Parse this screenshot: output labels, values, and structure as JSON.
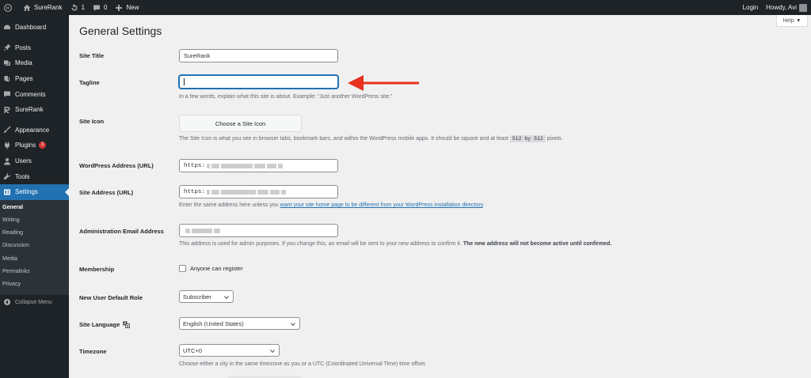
{
  "admin_bar": {
    "site_name": "SureRank",
    "updates_count": "1",
    "comments_count": "0",
    "new_label": "New",
    "login_label": "Login",
    "howdy_label": "Howdy, Avi"
  },
  "sidebar": {
    "items": [
      {
        "label": "Dashboard",
        "icon": "dashboard-icon"
      },
      {
        "label": "Posts",
        "icon": "pin-icon"
      },
      {
        "label": "Media",
        "icon": "media-icon"
      },
      {
        "label": "Pages",
        "icon": "pages-icon"
      },
      {
        "label": "Comments",
        "icon": "comment-icon"
      },
      {
        "label": "SureRank",
        "icon": "surerank-icon"
      },
      {
        "label": "Appearance",
        "icon": "brush-icon"
      },
      {
        "label": "Plugins",
        "icon": "plug-icon",
        "badge": "1"
      },
      {
        "label": "Users",
        "icon": "user-icon"
      },
      {
        "label": "Tools",
        "icon": "wrench-icon"
      },
      {
        "label": "Settings",
        "icon": "settings-icon"
      }
    ],
    "submenu": [
      "General",
      "Writing",
      "Reading",
      "Discussion",
      "Media",
      "Permalinks",
      "Privacy"
    ],
    "collapse_label": "Collapse Menu"
  },
  "help_label": "Help ▼",
  "page_title": "General Settings",
  "fields": {
    "site_title": {
      "label": "Site Title",
      "value": "SureRank"
    },
    "tagline": {
      "label": "Tagline",
      "value": "",
      "description": "In a few words, explain what this site is about. Example: “Just another WordPress site.”"
    },
    "site_icon": {
      "label": "Site Icon",
      "button": "Choose a Site Icon",
      "description_start": "The Site Icon is what you see in browser tabs, bookmark bars, and within the WordPress mobile apps. It should be square and at least",
      "size_w": "512 by 512",
      "description_end": "pixels."
    },
    "wp_address": {
      "label": "WordPress Address (URL)",
      "value": "https:"
    },
    "site_address": {
      "label": "Site Address (URL)",
      "value": "https:",
      "description_start": "Enter the same address here unless you",
      "description_link": "want your site home page to be different from your WordPress installation directory",
      "description_end": "."
    },
    "admin_email": {
      "label": "Administration Email Address",
      "description_start": "This address is used for admin purposes. If you change this, an email will be sent to your new address to confirm it.",
      "description_bold": "The new address will not become active until confirmed."
    },
    "membership": {
      "label": "Membership",
      "checkbox_label": "Anyone can register",
      "checked": false
    },
    "default_role": {
      "label": "New User Default Role",
      "value": "Subscriber"
    },
    "site_language": {
      "label": "Site Language",
      "value": "English (United States)"
    },
    "timezone": {
      "label": "Timezone",
      "value": "UTC+0",
      "description": "Choose either a city in the same timezone as you or a UTC (Coordinated Universal Time) time offset."
    }
  },
  "colors": {
    "admin_dark": "#1d2327",
    "accent_blue": "#2271b1",
    "annotation_arrow": "#e8311f",
    "badge_red": "#d63638"
  }
}
